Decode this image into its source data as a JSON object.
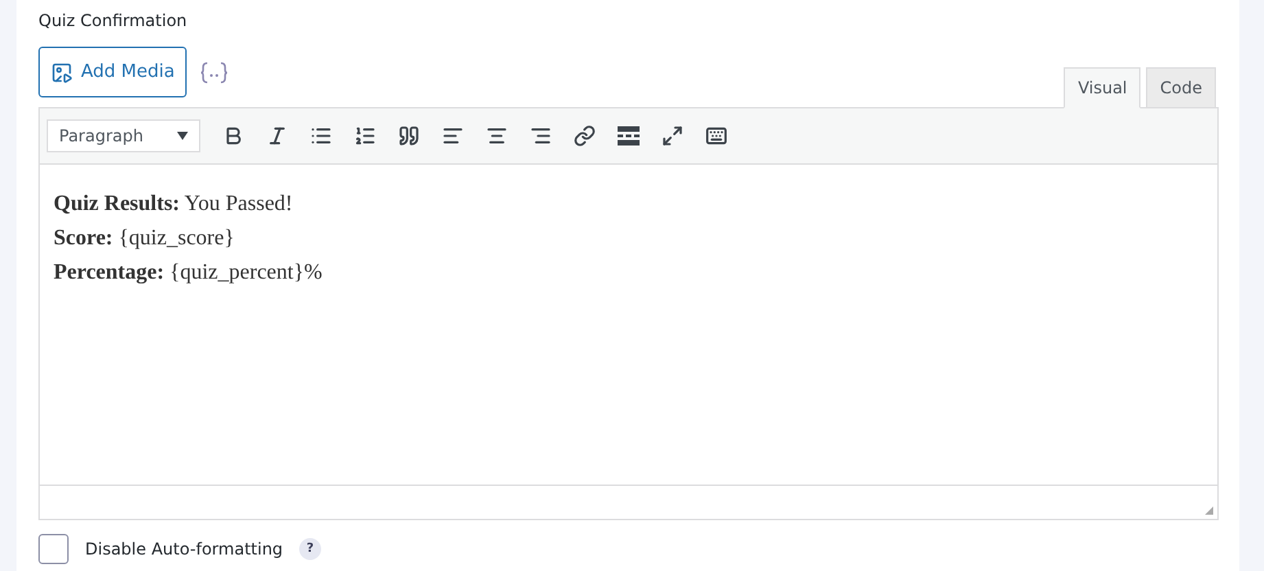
{
  "field_label": "Quiz Confirmation",
  "add_media_button": "Add Media",
  "tabs": [
    {
      "label": "Visual",
      "selected": true
    },
    {
      "label": "Code",
      "selected": false
    }
  ],
  "format_select": {
    "value": "Paragraph"
  },
  "toolbar": [
    {
      "kind": "bold"
    },
    {
      "kind": "italic"
    },
    {
      "kind": "bullet-list"
    },
    {
      "kind": "numbered-list"
    },
    {
      "kind": "quote"
    },
    {
      "kind": "align-left"
    },
    {
      "kind": "align-center"
    },
    {
      "kind": "align-right"
    },
    {
      "kind": "link"
    },
    {
      "kind": "read-more"
    },
    {
      "kind": "fullscreen"
    },
    {
      "kind": "toolbar-toggle"
    }
  ],
  "content": [
    "**Quiz Results:** You Passed!",
    "**Score:** {quiz_score}",
    "**Percentage:** {quiz_percent}%"
  ],
  "auto_format": {
    "label": "Disable Auto-formatting",
    "checked": false,
    "help": "?"
  }
}
